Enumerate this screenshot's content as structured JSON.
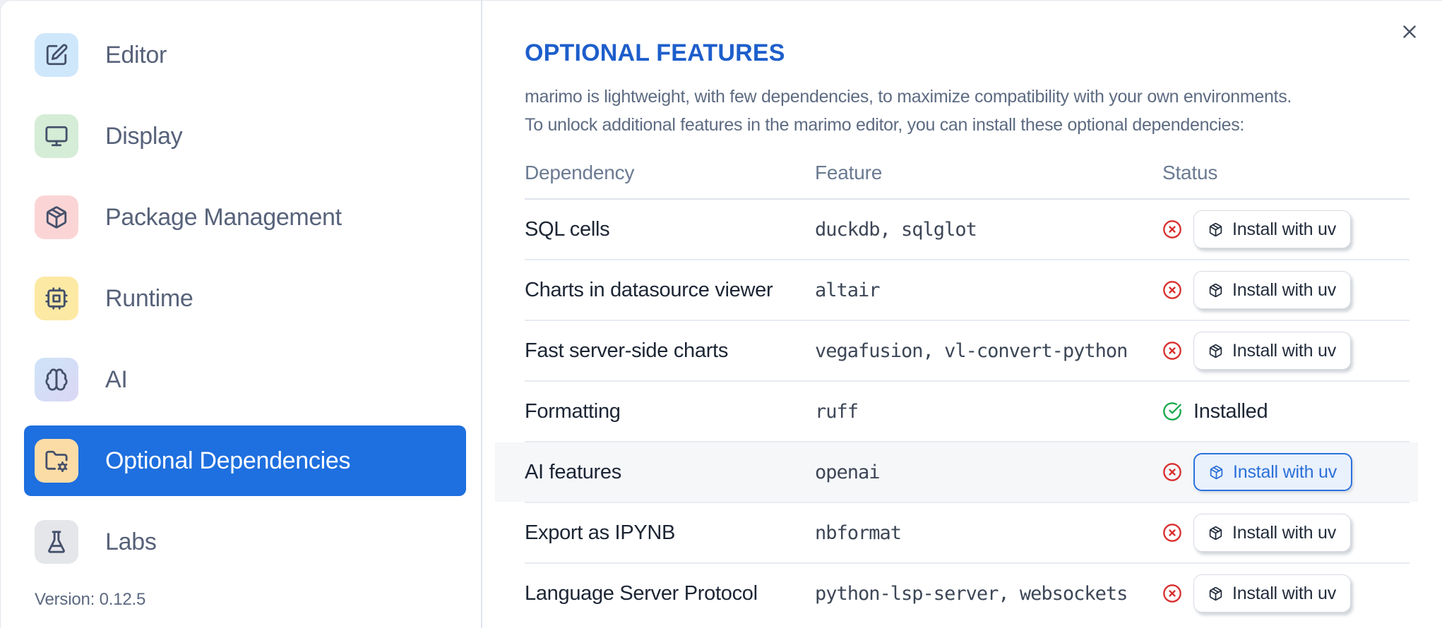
{
  "sidebar": {
    "items": [
      {
        "label": "Editor",
        "icon": "square-pen-icon",
        "icon_bg": "#cfe7fb",
        "active": false
      },
      {
        "label": "Display",
        "icon": "monitor-icon",
        "icon_bg": "#d5ecd6",
        "active": false
      },
      {
        "label": "Package Management",
        "icon": "package-icon",
        "icon_bg": "#fbd5d5",
        "active": false
      },
      {
        "label": "Runtime",
        "icon": "cpu-icon",
        "icon_bg": "#fce9a4",
        "active": false
      },
      {
        "label": "AI",
        "icon": "brain-icon",
        "icon_bg": "linear-gradient(135deg,#cde4f8,#dcd7f4)",
        "active": false
      },
      {
        "label": "Optional Dependencies",
        "icon": "folder-cog-icon",
        "icon_bg": "#fcdca6",
        "active": true
      },
      {
        "label": "Labs",
        "icon": "flask-icon",
        "icon_bg": "#e5e6e9",
        "active": false
      }
    ],
    "version_label": "Version: 0.12.5"
  },
  "main": {
    "title": "OPTIONAL FEATURES",
    "description_lines": [
      "marimo is lightweight, with few dependencies, to maximize compatibility with your own environments.",
      "To unlock additional features in the marimo editor, you can install these optional dependencies:"
    ],
    "close_icon": "x-icon",
    "table": {
      "columns": [
        "Dependency",
        "Feature",
        "Status"
      ],
      "rows": [
        {
          "dependency": "SQL cells",
          "feature": "duckdb, sqlglot",
          "installed": false,
          "status_icon": "circle-x-icon",
          "action_label": "Install with uv",
          "action_icon": "package-icon",
          "variant": "default",
          "highlighted": false
        },
        {
          "dependency": "Charts in datasource viewer",
          "feature": "altair",
          "installed": false,
          "status_icon": "circle-x-icon",
          "action_label": "Install with uv",
          "action_icon": "package-icon",
          "variant": "default",
          "highlighted": false
        },
        {
          "dependency": "Fast server-side charts",
          "feature": "vegafusion, vl-convert-python",
          "installed": false,
          "status_icon": "circle-x-icon",
          "action_label": "Install with uv",
          "action_icon": "package-icon",
          "variant": "default",
          "highlighted": false
        },
        {
          "dependency": "Formatting",
          "feature": "ruff",
          "installed": true,
          "status_icon": "circle-check-icon",
          "status_label": "Installed",
          "variant": "default",
          "highlighted": false
        },
        {
          "dependency": "AI features",
          "feature": "openai",
          "installed": false,
          "status_icon": "circle-x-icon",
          "action_label": "Install with uv",
          "action_icon": "package-icon",
          "variant": "primary",
          "highlighted": true
        },
        {
          "dependency": "Export as IPYNB",
          "feature": "nbformat",
          "installed": false,
          "status_icon": "circle-x-icon",
          "action_label": "Install with uv",
          "action_icon": "package-icon",
          "variant": "default",
          "highlighted": false
        },
        {
          "dependency": "Language Server Protocol",
          "feature": "python-lsp-server, websockets",
          "installed": false,
          "status_icon": "circle-x-icon",
          "action_label": "Install with uv",
          "action_icon": "package-icon",
          "variant": "default",
          "highlighted": false
        }
      ]
    }
  },
  "colors": {
    "accent_blue": "#1e6fdf",
    "heading_blue": "#1d5ecb",
    "error_red": "#d92f2f",
    "success_green": "#1ba94c"
  }
}
